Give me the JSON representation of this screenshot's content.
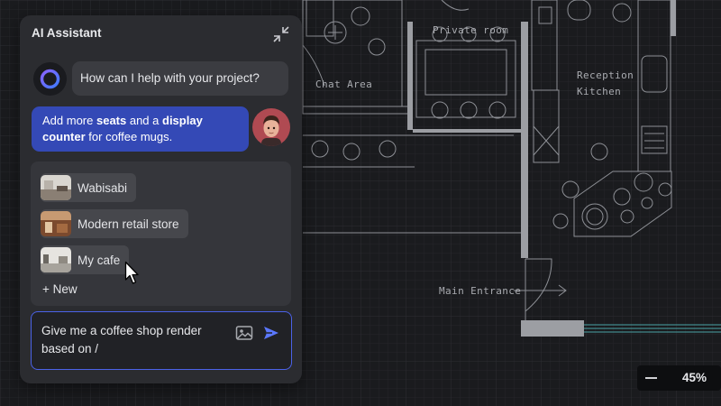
{
  "assistant": {
    "title": "AI Assistant",
    "greeting": "How can I help with your project?",
    "user_message": {
      "part1": "Add more ",
      "bold1": "seats",
      "part2": " and a ",
      "bold2": "display counter",
      "part3": " for coffee mugs."
    }
  },
  "projects": {
    "items": [
      {
        "label": "Wabisabi"
      },
      {
        "label": "Modern retail store"
      },
      {
        "label": "My cafe"
      }
    ],
    "new_label": "+ New"
  },
  "prompt": {
    "value": "Give me a coffee shop render based on /"
  },
  "floor_plan": {
    "labels": {
      "private_room": "Private room",
      "chat_area": "Chat Area",
      "reception": "Reception",
      "kitchen": "Kitchen",
      "main_entrance": "Main Entrance"
    }
  },
  "zoom": {
    "value": "45%"
  },
  "colors": {
    "accent": "#3449b6",
    "focus_border": "#4b62e8",
    "panel_bg": "#2b2c30",
    "canvas_bg": "#191a1d"
  },
  "icons": [
    "collapse-icon",
    "assistant-orb-icon",
    "image-icon",
    "send-icon",
    "minus-icon",
    "cursor-icon"
  ]
}
